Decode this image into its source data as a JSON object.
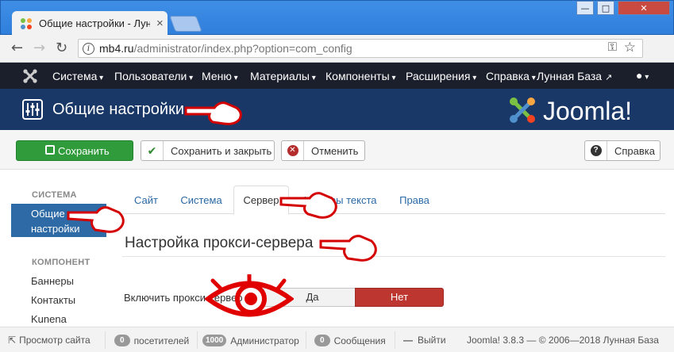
{
  "browser": {
    "tab_title": "Общие настройки - Лун",
    "url_host": "mb4.ru",
    "url_path": "/administrator/index.php?option=com_config"
  },
  "topnav": {
    "items": [
      "Система",
      "Пользователи",
      "Меню",
      "Материалы",
      "Компоненты",
      "Расширения",
      "Справка"
    ],
    "site_link": "Лунная База"
  },
  "header": {
    "title": "Общие настройки",
    "brand": "Joomla!"
  },
  "toolbar": {
    "save": "Сохранить",
    "save_close": "Сохранить и закрыть",
    "cancel": "Отменить",
    "help": "Справка"
  },
  "sidebar": {
    "section1": "СИСТЕМА",
    "active_item_line1": "Общие",
    "active_item_line2": "настройки",
    "section2": "КОМПОНЕНТ",
    "items": [
      "Баннеры",
      "Контакты",
      "Kunena"
    ]
  },
  "tabs": [
    "Сайт",
    "Система",
    "Сервер",
    "Фильтры текста",
    "Права"
  ],
  "active_tab": "Сервер",
  "content": {
    "section_title": "Настройка прокси-сервера",
    "proxy_label": "Включить прокси-сервер",
    "yes": "Да",
    "no": "Нет",
    "selected": "Нет"
  },
  "statusbar": {
    "view_site": "Просмотр сайта",
    "visitors_count": "0",
    "visitors_label": "посетителей",
    "admins_count": "1000",
    "admins_label": "Администратор",
    "messages_count": "0",
    "messages_label": "Сообщения",
    "logout": "Выйти",
    "version": "Joomla! 3.8.3  —  © 2006—2018 Лунная База"
  },
  "colors": {
    "nav_bg": "#1b1f2c",
    "header_bg": "#1a3867",
    "save_green": "#2f9b3b",
    "active_blue": "#2d6aa6",
    "no_red": "#bd362f"
  }
}
